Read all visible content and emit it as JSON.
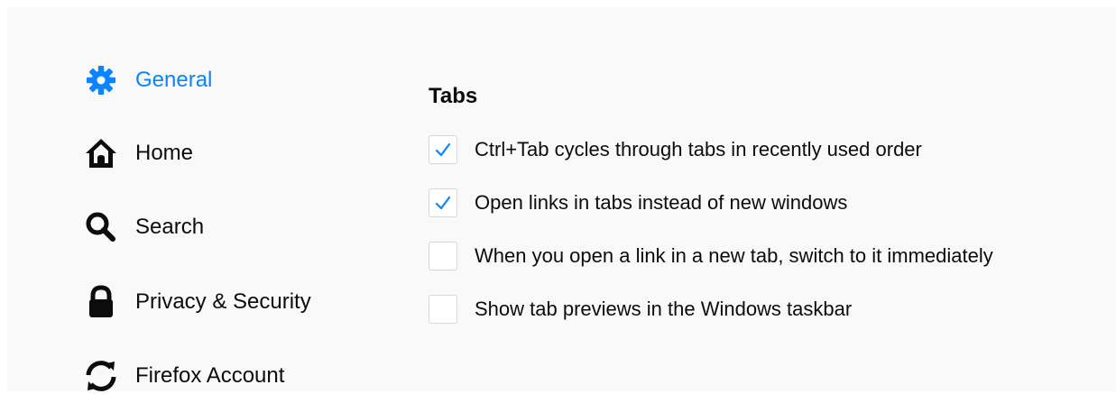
{
  "colors": {
    "accent": "#0a84ff",
    "text": "#0c0c0d",
    "background": "#f9f9fa"
  },
  "sidebar": {
    "items": [
      {
        "label": "General",
        "icon": "gear-icon",
        "active": true
      },
      {
        "label": "Home",
        "icon": "home-icon",
        "active": false
      },
      {
        "label": "Search",
        "icon": "search-icon",
        "active": false
      },
      {
        "label": "Privacy & Security",
        "icon": "lock-icon",
        "active": false
      },
      {
        "label": "Firefox Account",
        "icon": "sync-icon",
        "active": false
      }
    ]
  },
  "main": {
    "section_title": "Tabs",
    "options": [
      {
        "label": "Ctrl+Tab cycles through tabs in recently used order",
        "checked": true
      },
      {
        "label": "Open links in tabs instead of new windows",
        "checked": true
      },
      {
        "label": "When you open a link in a new tab, switch to it immediately",
        "checked": false
      },
      {
        "label": "Show tab previews in the Windows taskbar",
        "checked": false
      }
    ]
  }
}
